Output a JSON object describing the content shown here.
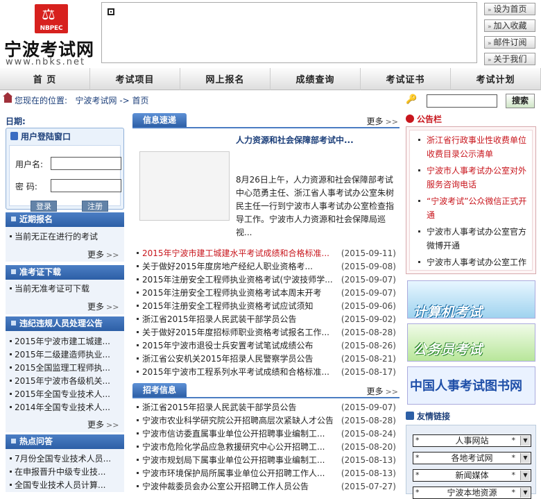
{
  "site": {
    "title": "宁波考试网",
    "url": "www.nbks.net",
    "logo_text": "NBPEC"
  },
  "toplinks": [
    "设为首页",
    "加入收藏",
    "邮件订阅",
    "关于我们"
  ],
  "nav": [
    "首  页",
    "考试项目",
    "网上报名",
    "成绩查询",
    "考试证书",
    "考试计划"
  ],
  "location": {
    "label": "您现在的位置:",
    "path": "宁波考试网 -> 首页"
  },
  "search": {
    "button": "搜索"
  },
  "left": {
    "date_label": "日期:",
    "login": {
      "title": "用户登陆窗口",
      "username_label": "用户名:",
      "password_label": "密  码:",
      "login_button": "登录",
      "register_button": "注册"
    },
    "recent_reg": {
      "title": "近期报名",
      "items": [
        "当前无正在进行的考试"
      ],
      "more": "更多"
    },
    "admission": {
      "title": "准考证下载",
      "items": [
        "当前无准考证可下载"
      ],
      "more": "更多"
    },
    "violation": {
      "title": "违纪违规人员处理公告",
      "items": [
        "2015年宁波市建工城建...",
        "2015年二级建造师执业...",
        "2015全国监理工程师执...",
        "2015年宁波市各级机关...",
        "2015年全国专业技术人...",
        "2014年全国专业技术人..."
      ],
      "more": "更多"
    },
    "faq": {
      "title": "热点问答",
      "items": [
        "7月份全国专业技术人员...",
        "在申报晋升中级专业技...",
        "全国专业技术人员计算..."
      ]
    }
  },
  "center": {
    "news": {
      "tab": "信息速递",
      "more": "更多",
      "featured_title": "人力资源和社会保障部考试中...",
      "featured_text": "8月26日上午，人力资源和社会保障部考试中心范勇主任、浙江省人事考试办公室朱树民主任一行到宁波市人事考试办公室检查指导工作。宁波市人力资源和社会保障局巡视...",
      "items": [
        {
          "title": "2015年宁波市建工城建水平考试成绩和合格标准...",
          "date": "(2015-09-11)"
        },
        {
          "title": "关于做好2015年度房地产经纪人职业资格考...",
          "date": "(2015-09-08)"
        },
        {
          "title": "2015年注册安全工程师执业资格考试(宁波技师学...",
          "date": "(2015-09-07)"
        },
        {
          "title": "2015年注册安全工程师执业资格考试本周末开考",
          "date": "(2015-09-07)"
        },
        {
          "title": "2015年注册安全工程师执业资格考试应试须知",
          "date": "(2015-09-06)"
        },
        {
          "title": "浙江省2015年招录人民武装干部学员公告",
          "date": "(2015-09-02)"
        },
        {
          "title": "关于做好2015年度招标师职业资格考试报名工作...",
          "date": "(2015-08-28)"
        },
        {
          "title": "2015年宁波市退役士兵安置考试笔试成绩公布",
          "date": "(2015-08-26)"
        },
        {
          "title": "浙江省公安机关2015年招录人民警察学员公告",
          "date": "(2015-08-21)"
        },
        {
          "title": "2015年宁波市工程系列水平考试成绩和合格标准...",
          "date": "(2015-08-17)"
        }
      ]
    },
    "recruit": {
      "tab": "招考信息",
      "more": "更多",
      "items": [
        {
          "title": "浙江省2015年招录人民武装干部学员公告",
          "date": "(2015-09-07)"
        },
        {
          "title": "宁波市农业科学研究院公开招聘高层次紧缺人才公告",
          "date": "(2015-08-28)"
        },
        {
          "title": "宁波市信访委直属事业单位公开招聘事业编制工...",
          "date": "(2015-08-24)"
        },
        {
          "title": "宁波市危险化学品应急救援研究中心公开招聘工...",
          "date": "(2015-08-20)"
        },
        {
          "title": "宁波市规划局下属事业单位公开招聘事业编制工...",
          "date": "(2015-08-13)"
        },
        {
          "title": "宁波市环境保护局所属事业单位公开招聘工作人...",
          "date": "(2015-08-13)"
        },
        {
          "title": "宁波仲裁委员会办公室公开招聘工作人员公告",
          "date": "(2015-07-27)"
        }
      ]
    }
  },
  "right": {
    "notice_title": "公告栏",
    "notices": [
      {
        "text": "浙江省行政事业性收费单位收费目录公示清单",
        "red": true
      },
      {
        "text": "宁波市人事考试办公室对外服务咨询电话",
        "red": true
      },
      {
        "text": "“宁波考试”公众微信正式开通",
        "red": true
      },
      {
        "text": "宁波市人事考试办公室官方微博开通",
        "red": false
      },
      {
        "text": "宁波市人事考试办公室工作时间",
        "red": false
      }
    ],
    "ads": [
      "计算机考试",
      "公务员考试",
      "中国人事考试图书网"
    ],
    "friend_title": "友情链接",
    "friend_selects": [
      "人事网站",
      "各地考试网",
      "新闻媒体",
      "宁波本地资源"
    ]
  },
  "colors": {
    "accent": "#2d5fa6",
    "red": "#c8161d",
    "green_ad": "#2f8a2f"
  }
}
